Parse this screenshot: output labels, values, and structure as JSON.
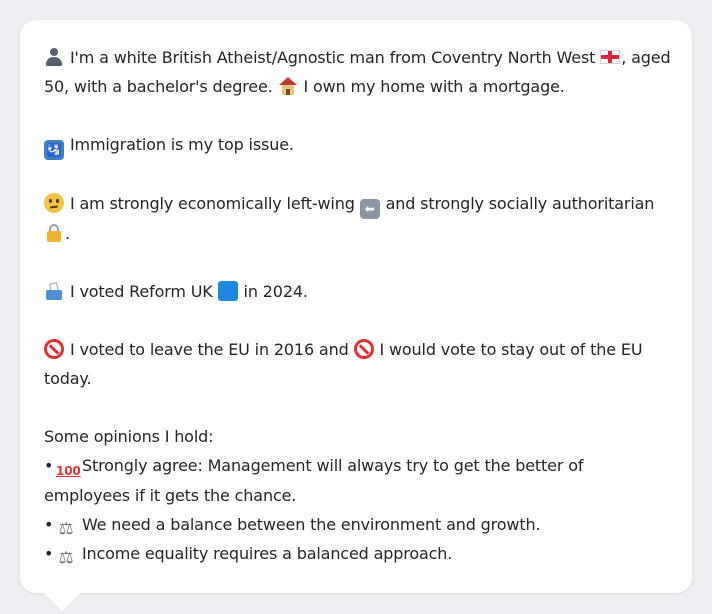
{
  "profile": {
    "intro_a": "I'm a white British Atheist/Agnostic man from Coventry North West",
    "intro_b": ", aged 50, with a bachelor's degree.",
    "intro_c": "I own my home with a mortgage.",
    "top_issue": "Immigration is my top issue.",
    "ideology_a": "I am strongly economically left-wing",
    "ideology_b": "and strongly socially authoritarian",
    "ideology_c": ".",
    "vote_a": "I voted Reform UK",
    "vote_b": "in 2024.",
    "eu_a": "I voted to leave the EU in 2016 and",
    "eu_b": "I would vote to stay out of the EU today.",
    "opinions_heading": "Some opinions I hold:",
    "bullet_char": "•",
    "opinions": [
      {
        "icon": "hundred-points-icon",
        "text": "Strongly agree: Management will always try to get the better of employees if it gets the chance."
      },
      {
        "icon": "balance-scale-icon",
        "text": "We need a balance between the environment and growth."
      },
      {
        "icon": "balance-scale-icon",
        "text": "Income equality requires a balanced approach."
      }
    ]
  },
  "icons": {
    "person": "bust-in-silhouette-icon",
    "flag": "england-flag-icon",
    "home": "house-icon",
    "immigration": "passport-control-icon",
    "thinking": "thinking-face-icon",
    "left": "left-arrow-icon",
    "authoritarian": "lock-icon",
    "ballot": "ballot-box-icon",
    "party_color": "blue-square-icon",
    "no_entry": "prohibited-icon"
  },
  "glyphs": {
    "left_arrow": "⬅",
    "passport": "🛂",
    "hundred": "100",
    "scales": "⚖"
  },
  "colors": {
    "background": "#eceef1",
    "card": "#ffffff",
    "text": "#212529",
    "party_blue": "#1e88e5",
    "no_entry_red": "#e03131"
  }
}
